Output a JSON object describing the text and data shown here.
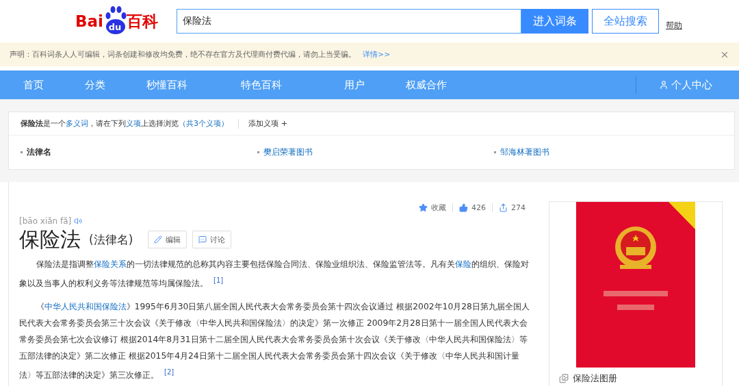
{
  "header": {
    "logo": {
      "left": "Bai",
      "paw": "du",
      "right": "百科"
    },
    "search": {
      "value": "保险法"
    },
    "buttons": [
      {
        "kind": "primary",
        "label": "进入词条"
      },
      {
        "kind": "outline",
        "label": "全站搜索"
      }
    ],
    "help_link": "帮助"
  },
  "notice": {
    "text": "声明：百科词条人人可编辑，词条创建和修改均免费，绝不存在官方及代理商付费代编，请勿上当受骗。",
    "link": "详情>>"
  },
  "nav": {
    "items": [
      "首页",
      "分类",
      "秒懂百科",
      "特色百科",
      "用户",
      "权威合作"
    ],
    "user_center": "个人中心"
  },
  "polysemant": {
    "intro": [
      {
        "kind": "bold",
        "text": "保险法"
      },
      {
        "kind": "plain",
        "text": "是一个"
      },
      {
        "kind": "link",
        "text": "多义词"
      },
      {
        "kind": "plain",
        "text": "，请在下列"
      },
      {
        "kind": "link",
        "text": "义项"
      },
      {
        "kind": "plain",
        "text": "上选择浏览"
      },
      {
        "kind": "link",
        "text": "（共3个义项）"
      }
    ],
    "add_item": "添加义项",
    "senses": [
      {
        "label": "法律名",
        "selected": true
      },
      {
        "label": "樊启荣著图书",
        "selected": false
      },
      {
        "label": "邹海林著图书",
        "selected": false
      }
    ]
  },
  "article": {
    "actions": [
      {
        "kind": "favorite",
        "label": "收藏"
      },
      {
        "kind": "like",
        "label": "426"
      },
      {
        "kind": "share",
        "label": "274"
      }
    ],
    "pinyin": "[bāo xiǎn fǎ]",
    "title": "保险法",
    "subtitle": "(法律名)",
    "buttons": [
      {
        "kind": "edit",
        "label": "编辑"
      },
      {
        "kind": "discuss",
        "label": "讨论"
      }
    ],
    "paragraphs": [
      [
        {
          "kind": "plain",
          "text": "保险法是指调整"
        },
        {
          "kind": "link",
          "text": "保险关系"
        },
        {
          "kind": "plain",
          "text": "的一切法律规范的总称其内容主要包括保险合同法、保险业组织法、保险监管法等。凡有关"
        },
        {
          "kind": "link",
          "text": "保险"
        },
        {
          "kind": "plain",
          "text": "的组织、保险对象以及当事人的权利义务等法律规范等均属保险法。"
        },
        {
          "kind": "ref",
          "text": "[1]"
        }
      ],
      [
        {
          "kind": "plain",
          "text": "《"
        },
        {
          "kind": "link",
          "text": "中华人民共和国保险法"
        },
        {
          "kind": "plain",
          "text": "》1995年6月30日第八届全国人民代表大会常务委员会第十四次会议通过 根据2002年10月28日第九届全国人民代表大会常务委员会第三十次会议《关于修改〈中华人民共和国保险法〉的决定》第一次修正 2009年2月28日第十一届全国人民代表大会常务委员会第七次会议修订 根据2014年8月31日第十二届全国人民代表大会常务委员会第十次会议《关于修改〈中华人民共和国保险法〉等五部法律的决定》第二次修正 根据2015年4月24日第十二届全国人民代表大会常务委员会第十四次会议《关于修改〈中华人民共和国计量法〉等五部法律的决定》第三次修正。"
        },
        {
          "kind": "ref",
          "text": "[2]"
        }
      ]
    ],
    "side": {
      "caption": "保险法图册"
    }
  }
}
